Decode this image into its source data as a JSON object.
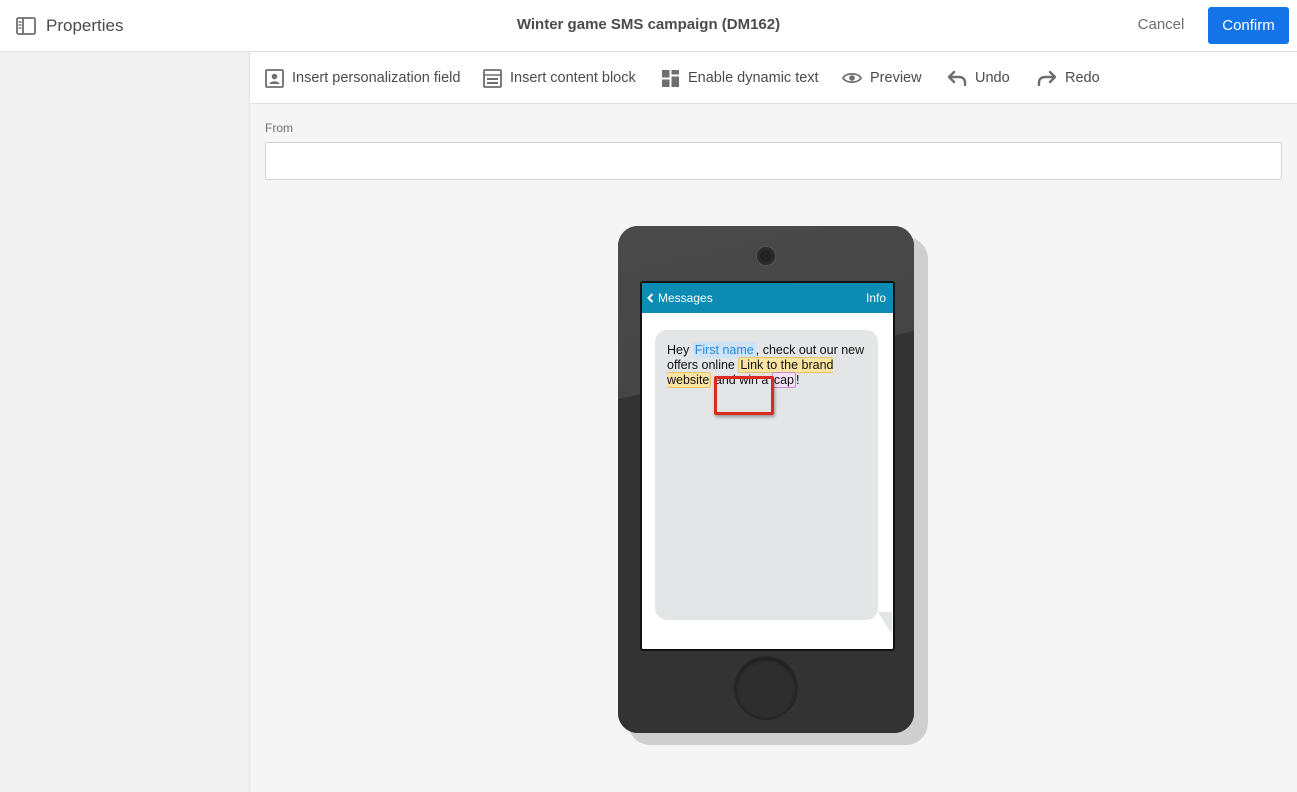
{
  "topbar": {
    "properties_label": "Properties",
    "title": "Winter game SMS campaign (DM162)",
    "cancel_label": "Cancel",
    "confirm_label": "Confirm"
  },
  "toolbar": {
    "insert_personalization_label": "Insert personalization field",
    "insert_content_block_label": "Insert content block",
    "enable_dynamic_text_label": "Enable dynamic text",
    "preview_label": "Preview",
    "undo_label": "Undo",
    "redo_label": "Redo"
  },
  "from_field": {
    "label": "From",
    "value": ""
  },
  "phone": {
    "back_label": "Messages",
    "info_label": "Info",
    "message": {
      "part1": "Hey ",
      "first_name_tag": "First name",
      "part2": ", check out our new offers online ",
      "link_tag": "Link to the brand website",
      "part3": " and win a ",
      "cap_tag": "cap",
      "part4": "!"
    }
  },
  "colors": {
    "accent": "#1473e6",
    "sms_header": "#0c8bb3",
    "highlight": "#d92b1f"
  }
}
